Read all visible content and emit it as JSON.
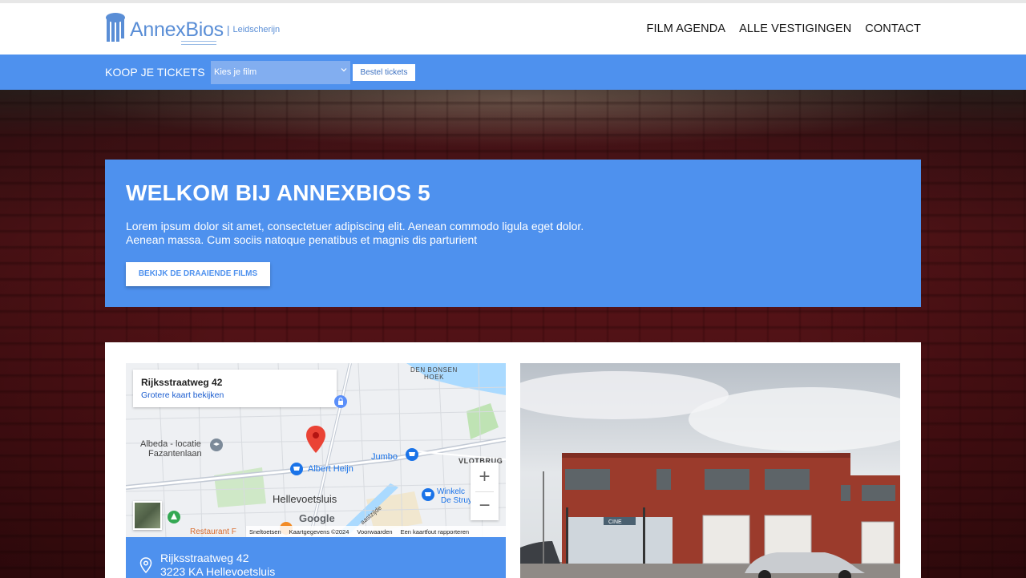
{
  "brand": {
    "name": "AnnexBios",
    "separator": "|",
    "location": "Leidscherijn",
    "color": "#5a8ed6"
  },
  "nav": {
    "items": [
      {
        "label": "FILM AGENDA"
      },
      {
        "label": "ALLE VESTIGINGEN"
      },
      {
        "label": "CONTACT"
      }
    ]
  },
  "ticketbar": {
    "label": "KOOP JE TICKETS",
    "select_value": "Kies je film",
    "button_label": "Bestel tickets",
    "accent": "#4e91ee"
  },
  "hero": {
    "title": "WELKOM BIJ ANNEXBIOS 5",
    "text": "Lorem ipsum dolor sit amet, consectetuer adipiscing elit. Aenean commodo ligula eget dolor. Aenean massa. Cum sociis natoque penatibus et magnis dis parturient",
    "cta_label": "BEKIJK DE DRAAIENDE FILMS"
  },
  "map": {
    "info_address": "Rijksstraatweg 42",
    "info_link": "Grotere kaart bekijken",
    "labels": {
      "den_bonsen": "DEN BONSEN",
      "hoek": "HOEK",
      "albeda1": "Albeda - locatie",
      "albeda2": "Fazantenlaan",
      "albert_heijn": "Albert Heijn",
      "jumbo": "Jumbo",
      "vlotbrug": "VLOTBRUG",
      "hellevoetsluis": "Hellevoetsluis",
      "winkel": "Winkelc",
      "struy": "De Struy",
      "restaurant": "Restaurant F",
      "straat": "aastzijde"
    },
    "google_label": "Google",
    "footer": [
      "Sneltoetsen",
      "Kaartgegevens ©2024",
      "Voorwaarden",
      "Een kaartfout rapporteren"
    ],
    "zoom_in": "+",
    "zoom_out": "−"
  },
  "address": {
    "line1": "Rijksstraatweg 42",
    "line2": "3223 KA Hellevoetsluis"
  },
  "photo": {
    "sign": "CINE"
  }
}
